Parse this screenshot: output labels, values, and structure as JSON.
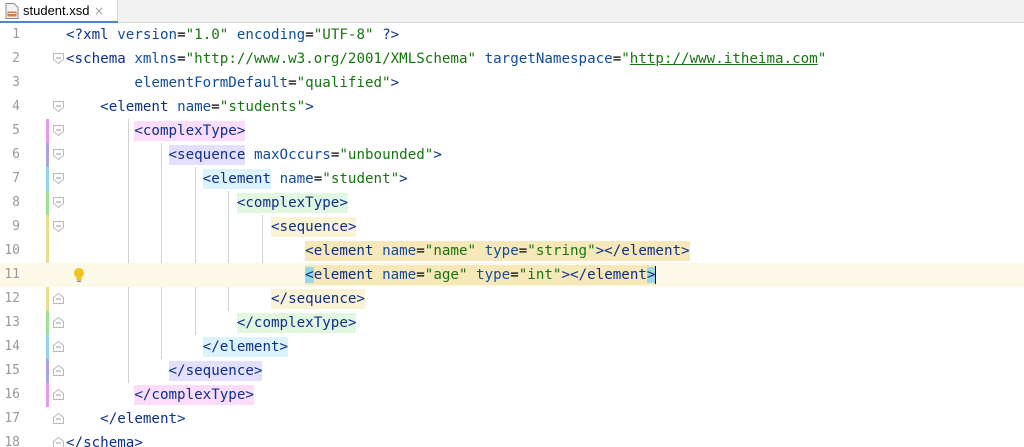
{
  "tab": {
    "filename": "student.xsd",
    "close": "×"
  },
  "line_numbers": [
    "1",
    "2",
    "3",
    "4",
    "5",
    "6",
    "7",
    "8",
    "9",
    "10",
    "11",
    "12",
    "13",
    "14",
    "15",
    "16",
    "17",
    "18"
  ],
  "code": {
    "l1": {
      "open": "<?",
      "tag": "xml",
      "a1": "version",
      "eq": "=",
      "v1": "\"1.0\"",
      "a2": "encoding",
      "v2": "\"UTF-8\"",
      "close": "?>"
    },
    "l2": {
      "open": "<",
      "tag": "schema",
      "a1": "xmlns",
      "eq": "=",
      "v1": "\"http://www.w3.org/2001/XMLSchema\"",
      "a2": "targetNamespace",
      "q": "\"",
      "url": "http://www.itheima.com"
    },
    "l3": {
      "a": "elementFormDefault",
      "eq": "=",
      "v": "\"qualified\"",
      "close": ">"
    },
    "l4": {
      "open": "<",
      "tag": "element",
      "a": "name",
      "eq": "=",
      "v": "\"students\"",
      "close": ">"
    },
    "l5": {
      "text": "<complexType>"
    },
    "l6": {
      "open": "<",
      "tag": "sequence",
      "a": "maxOccurs",
      "eq": "=",
      "v": "\"unbounded\"",
      "close": ">"
    },
    "l7": {
      "open": "<",
      "tag": "element",
      "a": "name",
      "eq": "=",
      "v": "\"student\"",
      "close": ">"
    },
    "l8": {
      "text": "<complexType>"
    },
    "l9": {
      "text": "<sequence>"
    },
    "l10": {
      "open": "<",
      "tag": "element",
      "a1": "name",
      "eq": "=",
      "v1": "\"name\"",
      "a2": "type",
      "v2": "\"string\"",
      "close": "></element>"
    },
    "l11": {
      "lt": "<",
      "tag": "element",
      "a1": "name",
      "eq": "=",
      "v1": "\"age\"",
      "a2": "type",
      "v2": "\"int\"",
      "mid": "></element",
      "gt": ">"
    },
    "l12": {
      "text": "</sequence>"
    },
    "l13": {
      "text": "</complexType>"
    },
    "l14": {
      "text": "</element>"
    },
    "l15": {
      "text": "</sequence>"
    },
    "l16": {
      "text": "</complexType>"
    },
    "l17": {
      "text": "</element>"
    },
    "l18": {
      "text": "</schema>"
    }
  },
  "colors": {
    "tag": "#0c2f8c",
    "attribute": "#114c9a",
    "value": "#16760e",
    "current_line": "#fcf9e9"
  },
  "icons": [
    "xsd-file-icon",
    "close-icon",
    "fold-icon",
    "intention-bulb-icon"
  ]
}
